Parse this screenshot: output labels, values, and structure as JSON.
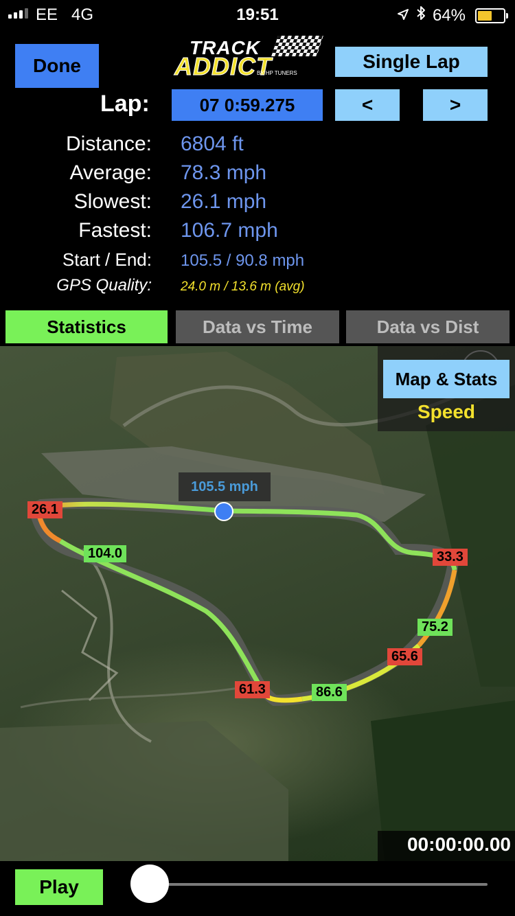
{
  "status_bar": {
    "carrier": "EE",
    "network": "4G",
    "time": "19:51",
    "battery_text": "64%",
    "battery_level": 0.64,
    "icons": [
      "signal-icon",
      "location-arrow-icon",
      "bluetooth-icon",
      "battery-icon"
    ]
  },
  "header": {
    "done_label": "Done",
    "logo_line1": "TRACK",
    "logo_line2": "ADDICT",
    "logo_tagline": "BY HP TUNERS",
    "single_lap_label": "Single Lap",
    "lap_label": "Lap:",
    "lap_value": "07  0:59.275",
    "prev_label": "<",
    "next_label": ">"
  },
  "stats": {
    "distance_label": "Distance:",
    "distance_value": "6804 ft",
    "average_label": "Average:",
    "average_value": "78.3 mph",
    "slowest_label": "Slowest:",
    "slowest_value": "26.1 mph",
    "fastest_label": "Fastest:",
    "fastest_value": "106.7 mph",
    "start_end_label": "Start / End:",
    "start_end_value": "105.5 / 90.8 mph",
    "gps_label": "GPS Quality:",
    "gps_value": "24.0 m / 13.6 m (avg)"
  },
  "tabs": [
    {
      "label": "Statistics",
      "active": true
    },
    {
      "label": "Data vs Time",
      "active": false
    },
    {
      "label": "Data vs Dist",
      "active": false
    }
  ],
  "map": {
    "map_stats_label": "Map & Stats",
    "speed_label": "Speed",
    "current_speed": "105.5 mph",
    "speed_markers": [
      "26.1",
      "104.0",
      "33.3",
      "75.2",
      "65.6",
      "61.3",
      "86.6"
    ],
    "colors": {
      "slow": "#e1473a",
      "mid": "#f3e12d",
      "fast": "#6fe25a",
      "marker": "#3f7ff3"
    }
  },
  "playback": {
    "timer": "00:00:00.00",
    "play_label": "Play",
    "progress": 0.0
  }
}
